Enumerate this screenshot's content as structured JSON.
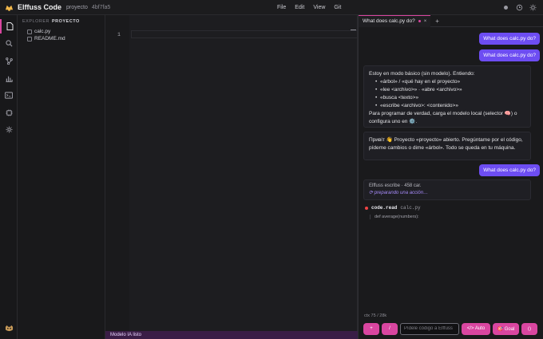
{
  "topbar": {
    "app_name": "Elffuss Code",
    "project": "proyecto",
    "hash": "4bf7fa5"
  },
  "menu": {
    "items": [
      "File",
      "Edit",
      "View",
      "Git"
    ]
  },
  "explorer": {
    "header": "EXPLORER",
    "folder": "PROYECTO",
    "files": [
      "calc.py",
      "README.md"
    ]
  },
  "editor": {
    "line_number": "1"
  },
  "statusbar": {
    "text": "Modelo IA listo"
  },
  "chat": {
    "tab_label": "What does calc.py do?",
    "tab_close": "×",
    "tab_add": "+",
    "user_messages": [
      "What does calc.py do?",
      "What does calc.py do?",
      "What does calc.py do?"
    ],
    "bot_intro": {
      "title": "Estoy en modo básico (sin modelo). Entiendo:",
      "bullets": [
        "«árbol» / «qué hay en el proyecto»",
        "«lee <archivo>» · «abre <archivo>»",
        "«busca <texto>»",
        "«escribe <archivo>: <contenido>»"
      ],
      "footer": "Para programar de verdad, carga el modelo local (selector 🧠) o configura uno en ⚙️."
    },
    "bot_greeting": "Привіт 👋 Proyecto «proyecto» abierto. Pregúntame por el código, pídeme cambios o dime «árbol». Todo se queda en tu máquina.",
    "working": {
      "line1": "Elffuss escribe · 458 car.",
      "line2": "⟳ preparando una acción…"
    },
    "tool": {
      "name": "code.read",
      "arg": "calc.py",
      "output": "def average(numbers):"
    },
    "ctx": "ctx 75 / 28k",
    "composer": {
      "plus": "+",
      "slash": "/",
      "placeholder": "Pídele código a Elffuss",
      "auto": "</> Auto",
      "goal": "🎯 Goal",
      "send": "⟨⟩"
    }
  },
  "colors": {
    "accent": "#d946a0",
    "user_bubble": "#6d4df2",
    "status_bar": "#3a1d46"
  }
}
